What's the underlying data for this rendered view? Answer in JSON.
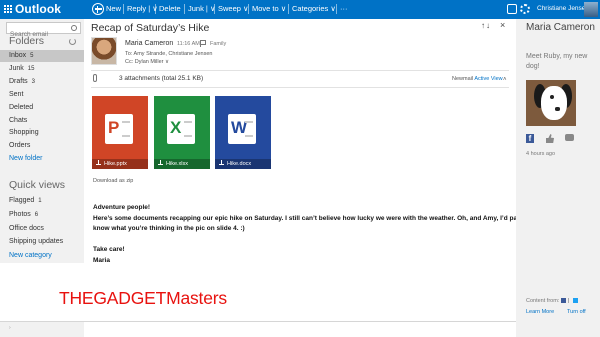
{
  "app": {
    "title": "Outlook",
    "user_name": "Christiane Jensen"
  },
  "toolbar": {
    "new_label": "New",
    "reply_label": "Reply | ∨",
    "delete_label": "Delete",
    "junk_label": "Junk | ∨",
    "sweep_label": "Sweep ∨",
    "moveto_label": "Move to ∨",
    "categories_label": "Categories ∨",
    "more_label": "···",
    "help_label": "?"
  },
  "sidebar": {
    "search_placeholder": "Search email",
    "folders_heading": "Folders",
    "folders": [
      {
        "label": "Inbox",
        "count": "5"
      },
      {
        "label": "Junk",
        "count": "15"
      },
      {
        "label": "Drafts",
        "count": "3"
      },
      {
        "label": "Sent",
        "count": ""
      },
      {
        "label": "Deleted",
        "count": ""
      },
      {
        "label": "Chats",
        "count": ""
      },
      {
        "label": "Shopping",
        "count": ""
      },
      {
        "label": "Orders",
        "count": ""
      }
    ],
    "new_folder": "New folder",
    "quick_views_heading": "Quick views",
    "quick_views": [
      {
        "label": "Flagged",
        "count": "1"
      },
      {
        "label": "Photos",
        "count": "6"
      },
      {
        "label": "Office docs",
        "count": ""
      },
      {
        "label": "Shipping updates",
        "count": ""
      }
    ],
    "new_category": "New category"
  },
  "message": {
    "subject": "Recap of Saturday’s Hike",
    "arrows": "↑↓",
    "close": "×",
    "sender": "Maria Cameron",
    "time": "11:16 AM",
    "category": "Family",
    "to_line": "To: Amy Strande, Christiane Jensen",
    "cc_line": "Cc: Dylan Miller ∨",
    "attachments_summary": "3 attachments (total 25.1 KB)",
    "view_label": "Newmail",
    "active_view": "Active View",
    "collapse_caret": "˄",
    "attachments": [
      {
        "name": "Hike.pptx",
        "letter": "P",
        "color": "#d04526"
      },
      {
        "name": "Hike.xlsx",
        "letter": "X",
        "color": "#1f8f3f"
      },
      {
        "name": "Hike.docx",
        "letter": "W",
        "color": "#244a9e"
      }
    ],
    "download_zip": "Download as zip",
    "body": {
      "greeting": "Adventure people!",
      "line1": "Here’s some documents recapping our epic hike on Saturday. I still can’t believe how lucky we were with the weather. Oh, and Amy, I’d pay a ton of $$ to",
      "line2": "know what you’re thinking in the pic on slide 4.  :)",
      "closing": "Take care!",
      "signature": "Maria"
    }
  },
  "people_pane": {
    "name": "Maria Cameron",
    "status": "Meet Ruby, my new dog!",
    "time_ago": "4 hours ago",
    "content_from": "Content from:",
    "learn_more": "Learn More",
    "turn_off": "Turn off"
  },
  "overlay": {
    "watermark": "THEGADGETMasters",
    "bottom_mark": "›"
  }
}
